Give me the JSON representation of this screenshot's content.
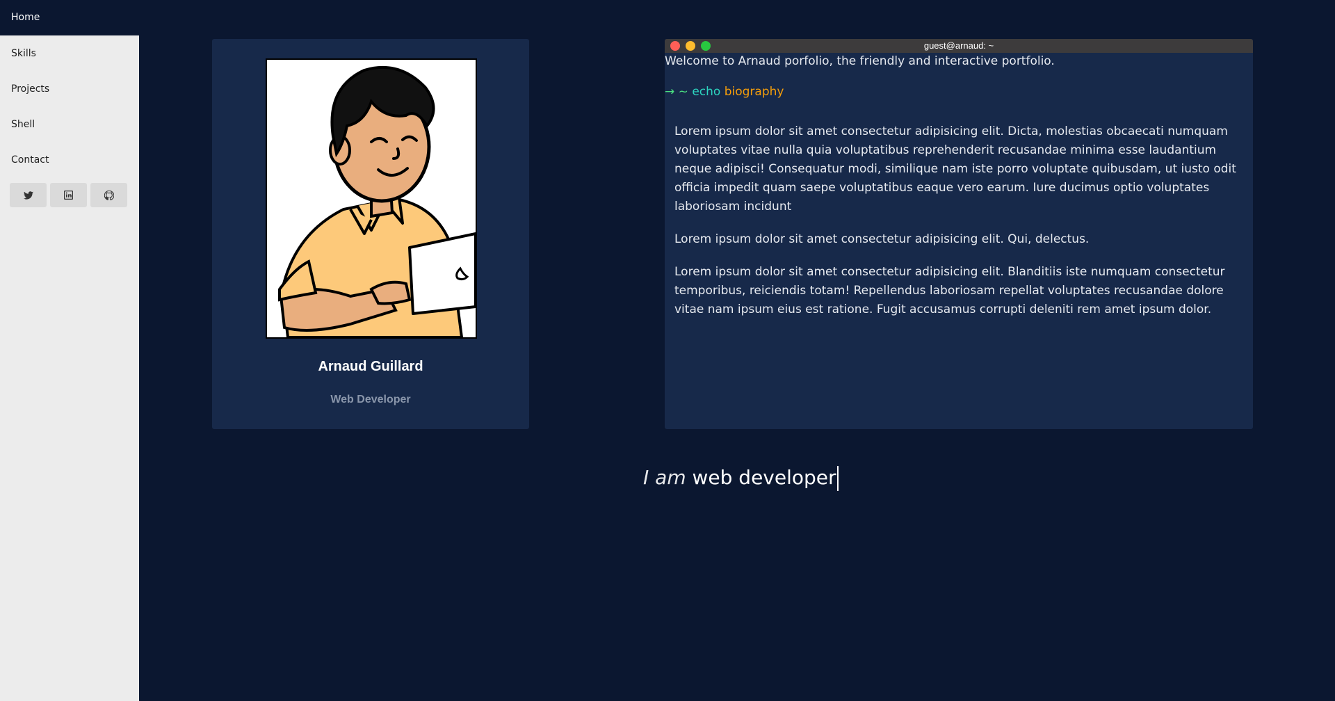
{
  "nav": {
    "home": "Home",
    "skills": "Skills",
    "projects": "Projects",
    "shell": "Shell",
    "contact": "Contact"
  },
  "social": [
    {
      "icon": "twitter-icon"
    },
    {
      "icon": "linkedin-icon"
    },
    {
      "icon": "github-icon"
    }
  ],
  "profile": {
    "name": "Arnaud Guillard",
    "role": "Web Developer"
  },
  "terminal": {
    "title": "guest@arnaud: ~",
    "welcome": "Welcome to Arnaud porfolio, the friendly and interactive portfolio.",
    "prompt_arrow": "→ ~",
    "command": "echo",
    "argument": "biography",
    "paragraphs": [
      "Lorem ipsum dolor sit amet consectetur adipisicing elit. Dicta, molestias obcaecati numquam voluptates vitae nulla quia voluptatibus reprehenderit recusandae minima esse laudantium neque adipisci! Consequatur modi, similique nam iste porro voluptate quibusdam, ut iusto odit officia impedit quam saepe voluptatibus eaque vero earum. Iure ducimus optio voluptates laboriosam incidunt",
      "Lorem ipsum dolor sit amet consectetur adipisicing elit. Qui, delectus.",
      "Lorem ipsum dolor sit amet consectetur adipisicing elit. Blanditiis iste numquam consectetur temporibus, reiciendis totam! Repellendus laboriosam repellat voluptates recusandae dolore vitae nam ipsum eius est ratione. Fugit accusamus corrupti deleniti rem amet ipsum dolor."
    ]
  },
  "tagline": {
    "lead": "I am",
    "role": "web developer"
  },
  "colors": {
    "background": "#0b1730",
    "card": "#17294a",
    "sidebar": "#ececec",
    "prompt_green": "#4ade80",
    "command_teal": "#2dd4bf",
    "argument_orange": "#f59e0b",
    "dot_red": "#ff5f57",
    "dot_yellow": "#febc2e",
    "dot_green": "#28c840"
  }
}
